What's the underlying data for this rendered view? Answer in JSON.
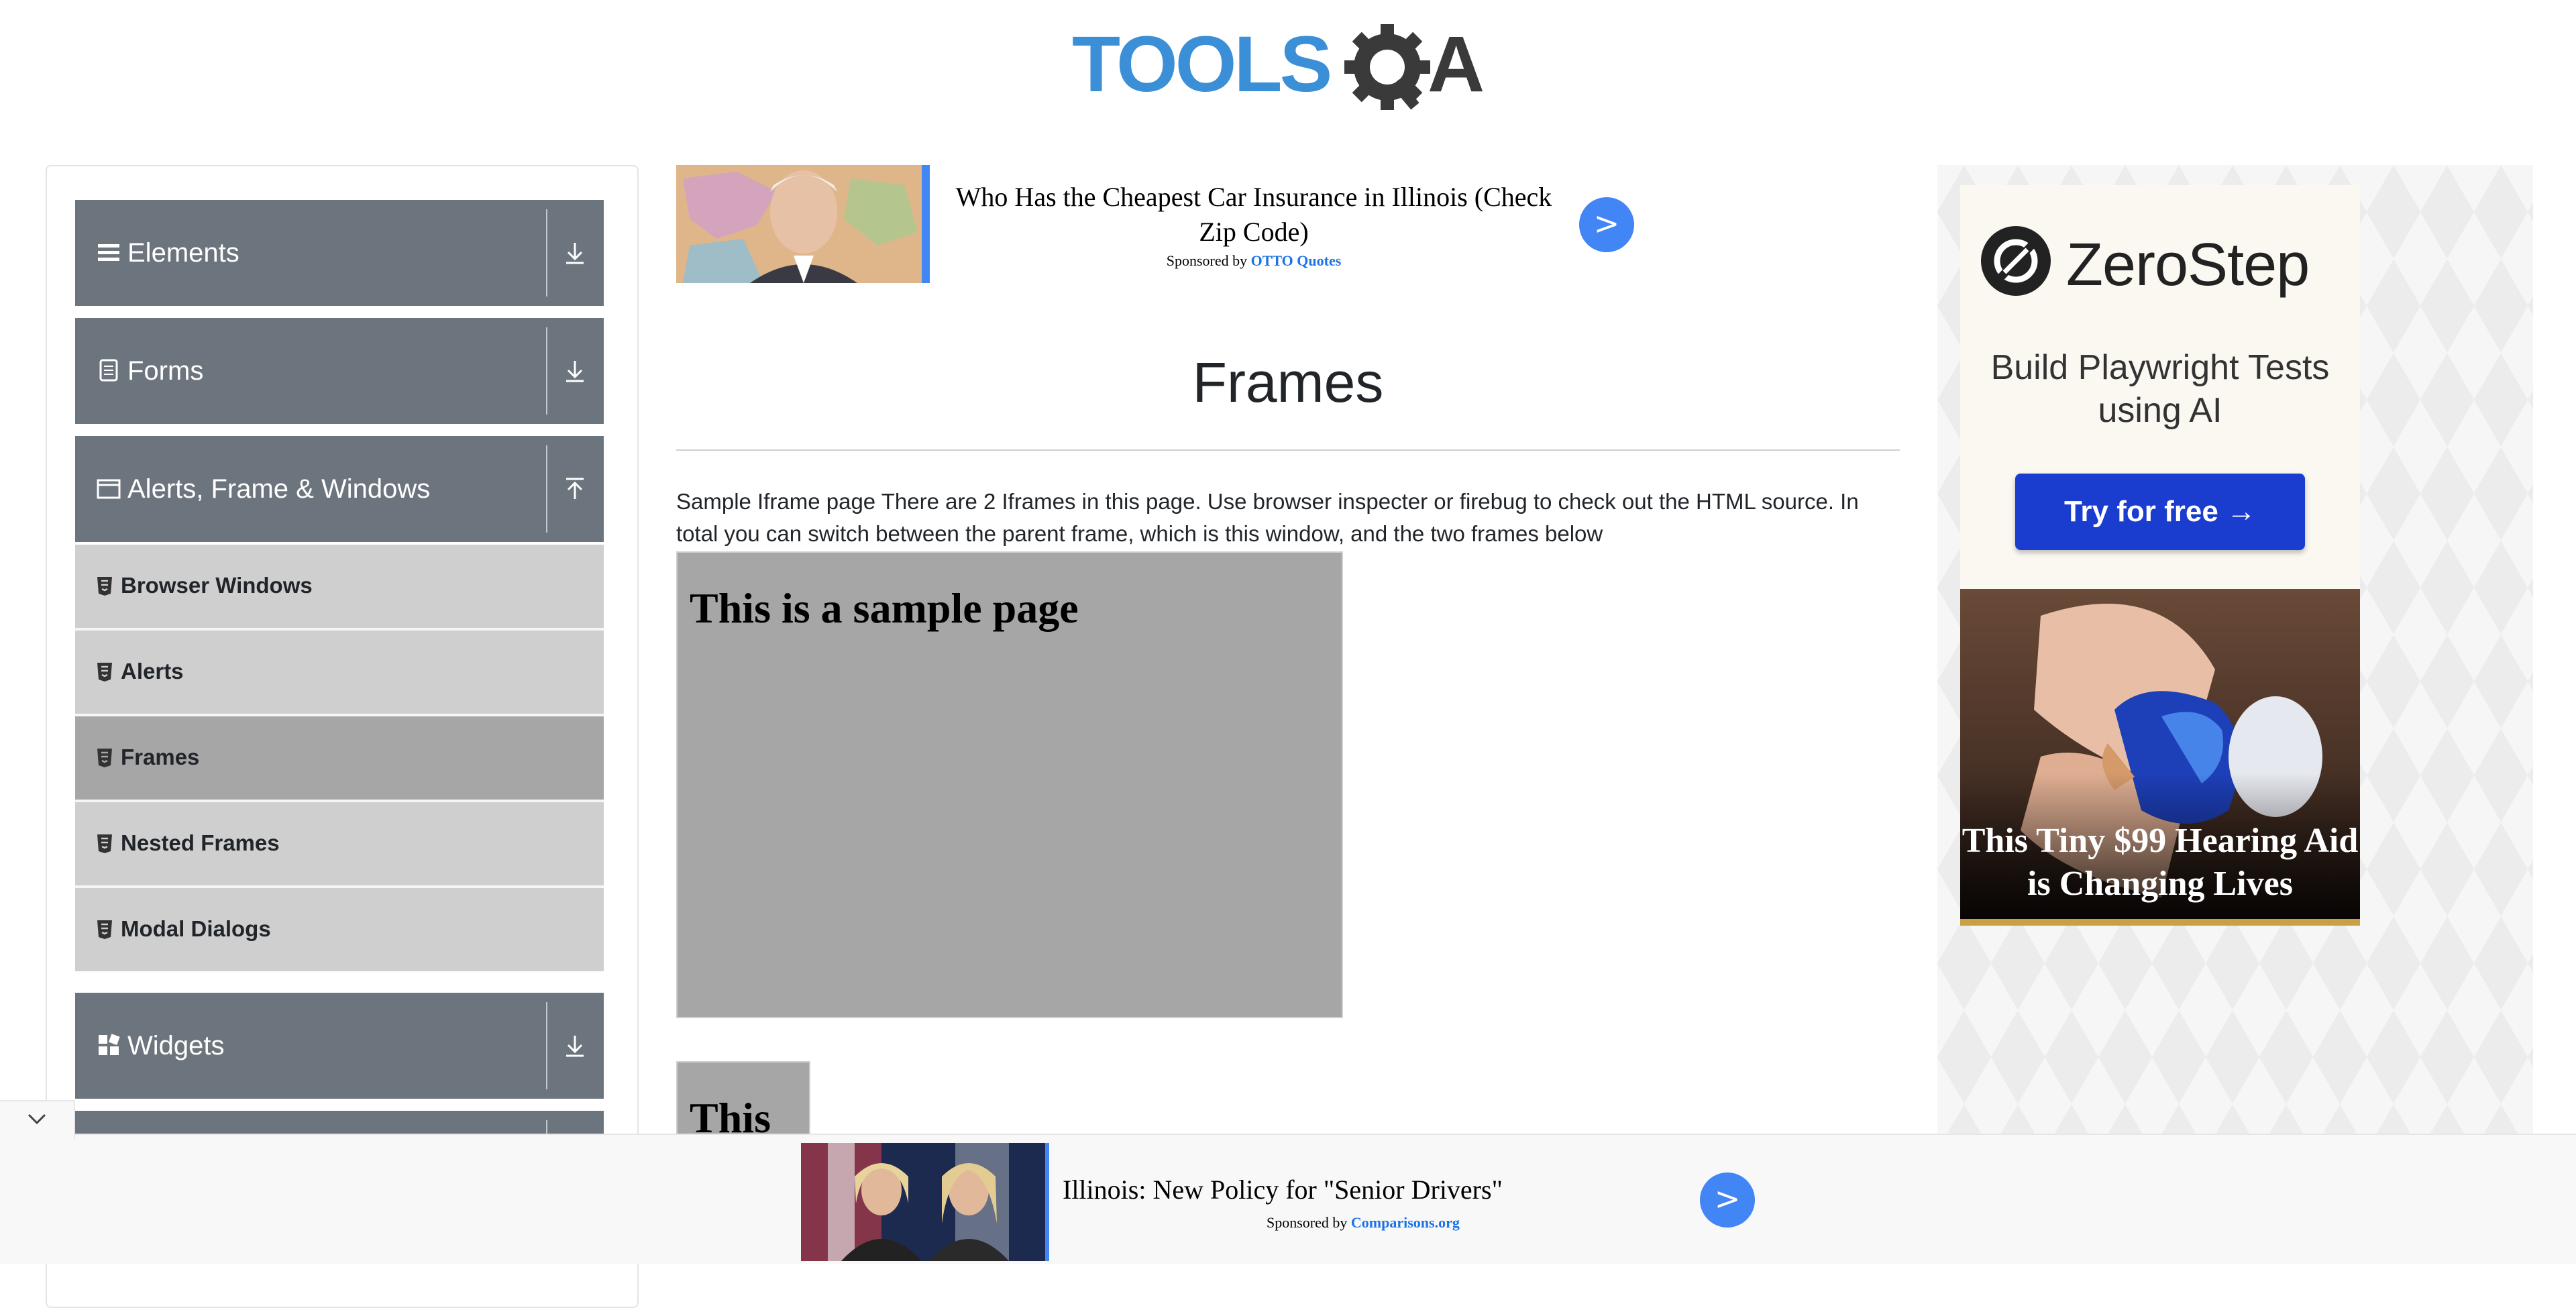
{
  "header": {
    "logo_text": "TOOLSQA"
  },
  "sidebar": {
    "groups": [
      {
        "label": "Elements",
        "icon": "hamburger-icon",
        "expanded": false
      },
      {
        "label": "Forms",
        "icon": "document-icon",
        "expanded": false
      },
      {
        "label": "Alerts, Frame & Windows",
        "icon": "window-icon",
        "expanded": true
      },
      {
        "label": "Widgets",
        "icon": "widgets-icon",
        "expanded": false
      }
    ],
    "items": [
      {
        "label": "Browser Windows",
        "active": false
      },
      {
        "label": "Alerts",
        "active": false
      },
      {
        "label": "Frames",
        "active": true
      },
      {
        "label": "Nested Frames",
        "active": false
      },
      {
        "label": "Modal Dialogs",
        "active": false
      }
    ]
  },
  "top_ad": {
    "title": "Who Has the Cheapest Car Insurance in Illinois (Check Zip Code)",
    "sponsored_by": "Sponsored by",
    "sponsor": "OTTO Quotes",
    "button": ">"
  },
  "main": {
    "title": "Frames",
    "description": "Sample Iframe page There are 2 Iframes in this page. Use browser inspecter or firebug to check out the HTML source. In total you can switch between the parent frame, which is this window, and the two frames below",
    "frame1_heading": "This is a sample page",
    "frame2_heading": "This"
  },
  "right_ad": {
    "brand": "ZeroStep",
    "headline": "Build Playwright Tests using AI",
    "cta": "Try for free →",
    "caption": "This Tiny $99 Hearing Aid is Changing Lives"
  },
  "bottom_ad": {
    "title": "Illinois: New Policy for \"Senior Drivers\"",
    "sponsored_by": "Sponsored by",
    "sponsor": "Comparisons.org",
    "button": ">"
  },
  "colors": {
    "sidebar_header": "#6c757d",
    "sidebar_item": "#cfcfcf",
    "sidebar_item_active": "#a6a6a6",
    "ad_blue": "#4285f4",
    "logo_blue": "#3b8fd6",
    "logo_dark": "#3a3a3a"
  }
}
